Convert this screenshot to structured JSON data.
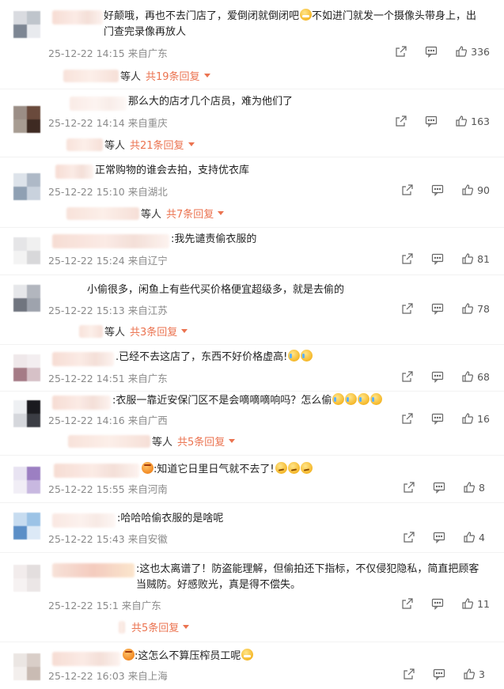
{
  "labels": {
    "replies_prefix": "等人",
    "replies_fmt_pre": "共",
    "replies_fmt_post": "条回复"
  },
  "comments": [
    {
      "text": "好颠哦，再也不去门店了，爱倒闭就倒闭吧",
      "text_emojis": [
        "grimace"
      ],
      "text2": "不如进门就发一个摄像头带身上，出门查完录像再放人",
      "time": "25-12-22 14:15",
      "location": "来自广东",
      "likes": "336",
      "replies": "共19条回复"
    },
    {
      "text": "那么大的店才几个店员，难为他们了",
      "time": "25-12-22 14:14",
      "location": "来自重庆",
      "likes": "163",
      "replies": "共21条回复"
    },
    {
      "text": "正常购物的谁会去拍，支持优衣库",
      "time": "25-12-22 15:10",
      "location": "来自湖北",
      "likes": "90",
      "replies": "共7条回复"
    },
    {
      "text": ":我先谴责偷衣服的",
      "time": "25-12-22 15:24",
      "location": "来自辽宁",
      "likes": "81"
    },
    {
      "text": "小偷很多，闲鱼上有些代买价格便宜超级多，就是去偷的",
      "time": "25-12-22 15:13",
      "location": "来自江苏",
      "likes": "78",
      "replies": "共3条回复"
    },
    {
      "text": ".已经不去这店了，东西不好价格虚高!",
      "time": "25-12-22 14:51",
      "location": "来自广东",
      "likes": "68"
    },
    {
      "text": ":衣服一靠近安保门区不是会嘀嘀嘀响吗？怎么偷",
      "time": "25-12-22 14:16",
      "location": "来自广西",
      "likes": "16",
      "replies": "共5条回复"
    },
    {
      "text": ":知道它日里日气就不去了!",
      "time": "25-12-22 15:55",
      "location": "来自河南",
      "likes": "8"
    },
    {
      "text": ":哈哈哈偷衣服的是啥呢",
      "time": "25-12-22 15:43",
      "location": "来自安徽",
      "likes": "4"
    },
    {
      "text": ":这也太离谱了！防盗能理解，但偷拍还下指标，不仅侵犯隐私，简直把顾客当贼防。好感败光，真是得不偿失。",
      "time": "25-12-22 15:1",
      "location": "来自广东",
      "likes": "11",
      "replies": "共5条回复"
    },
    {
      "text": ":这怎么不算压榨员工呢",
      "time": "25-12-22 16:03",
      "location": "来自上海",
      "likes": "3"
    }
  ]
}
